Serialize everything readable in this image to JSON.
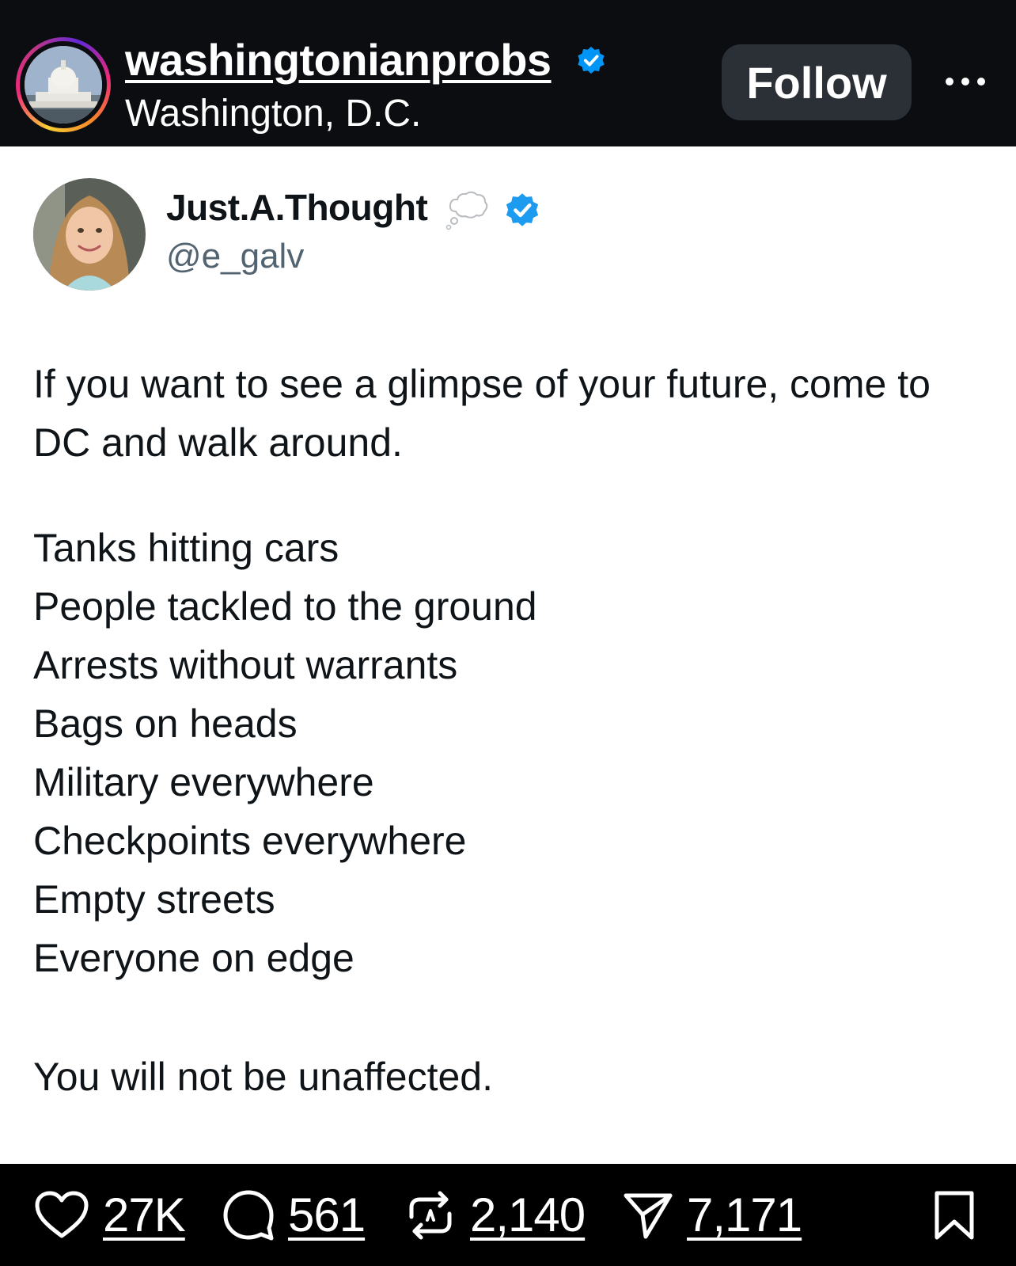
{
  "header": {
    "username": "washingtonianprobs",
    "location": "Washington, D.C.",
    "follow_label": "Follow",
    "verified_color": "#0095f6"
  },
  "tweet": {
    "display_name": "Just.A.Thought",
    "handle": "@e_galv",
    "verified_color": "#1d9bf0",
    "intro": "If you want to see a glimpse of your future, come to DC and walk around.",
    "list": [
      "Tanks hitting cars",
      "People tackled to the ground",
      "Arrests without warrants",
      "Bags on heads",
      "Military everywhere",
      "Checkpoints everywhere",
      "Empty streets",
      "Everyone on edge"
    ],
    "closing": "You will not be unaffected."
  },
  "actions": {
    "likes": "27K",
    "comments": "561",
    "reposts": "2,140",
    "shares": "7,171"
  },
  "icons": {
    "header": [
      "capitol-avatar",
      "verified-badge-icon",
      "more-options-icon"
    ],
    "tweet": [
      "profile-photo",
      "thought-balloon-icon",
      "verified-badge-icon"
    ],
    "actions": [
      "heart-icon",
      "comment-icon",
      "repost-icon",
      "share-icon",
      "bookmark-icon"
    ]
  }
}
